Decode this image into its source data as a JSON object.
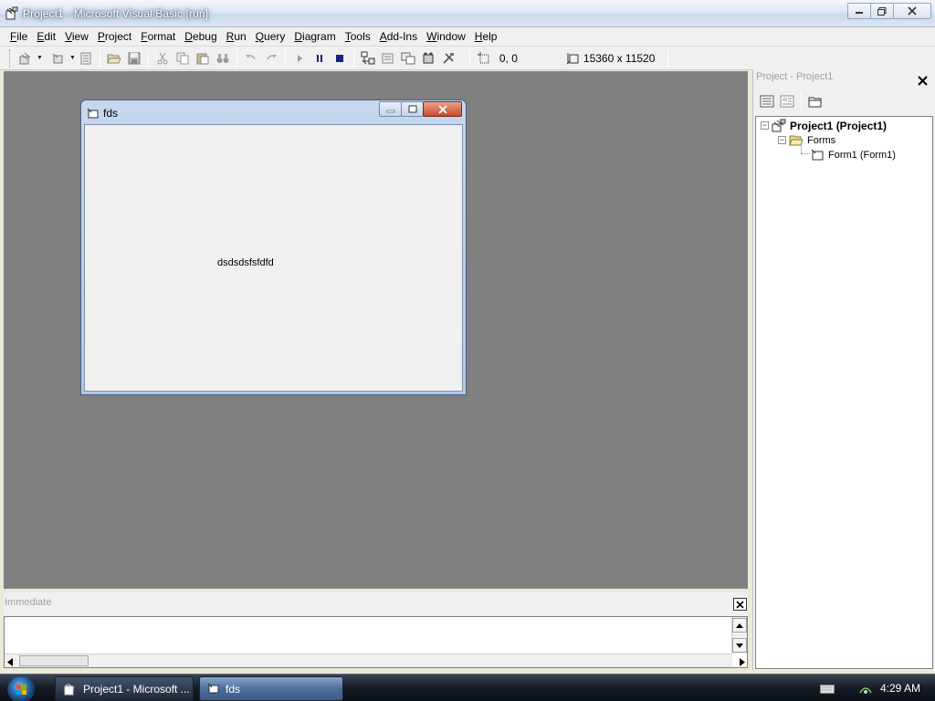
{
  "window": {
    "title": "Project1 - Microsoft Visual Basic [run]"
  },
  "menu": [
    "File",
    "Edit",
    "View",
    "Project",
    "Format",
    "Debug",
    "Run",
    "Query",
    "Diagram",
    "Tools",
    "Add-Ins",
    "Window",
    "Help"
  ],
  "toolbar": {
    "position_readout": "0, 0",
    "size_readout": "15360 x 11520"
  },
  "form": {
    "title": "fds",
    "label_text": "dsdsdsfsfdfd"
  },
  "immediate": {
    "title": "Immediate"
  },
  "project_explorer": {
    "title": "Project - Project1",
    "root": "Project1 (Project1)",
    "folder": "Forms",
    "item": "Form1 (Form1)"
  },
  "taskbar": {
    "buttons": [
      {
        "label": "Project1 - Microsoft ..."
      },
      {
        "label": "fds"
      }
    ],
    "clock": "4:29 AM"
  },
  "colors": {
    "mdi_background": "#808080",
    "taskbar": "#151c25"
  }
}
